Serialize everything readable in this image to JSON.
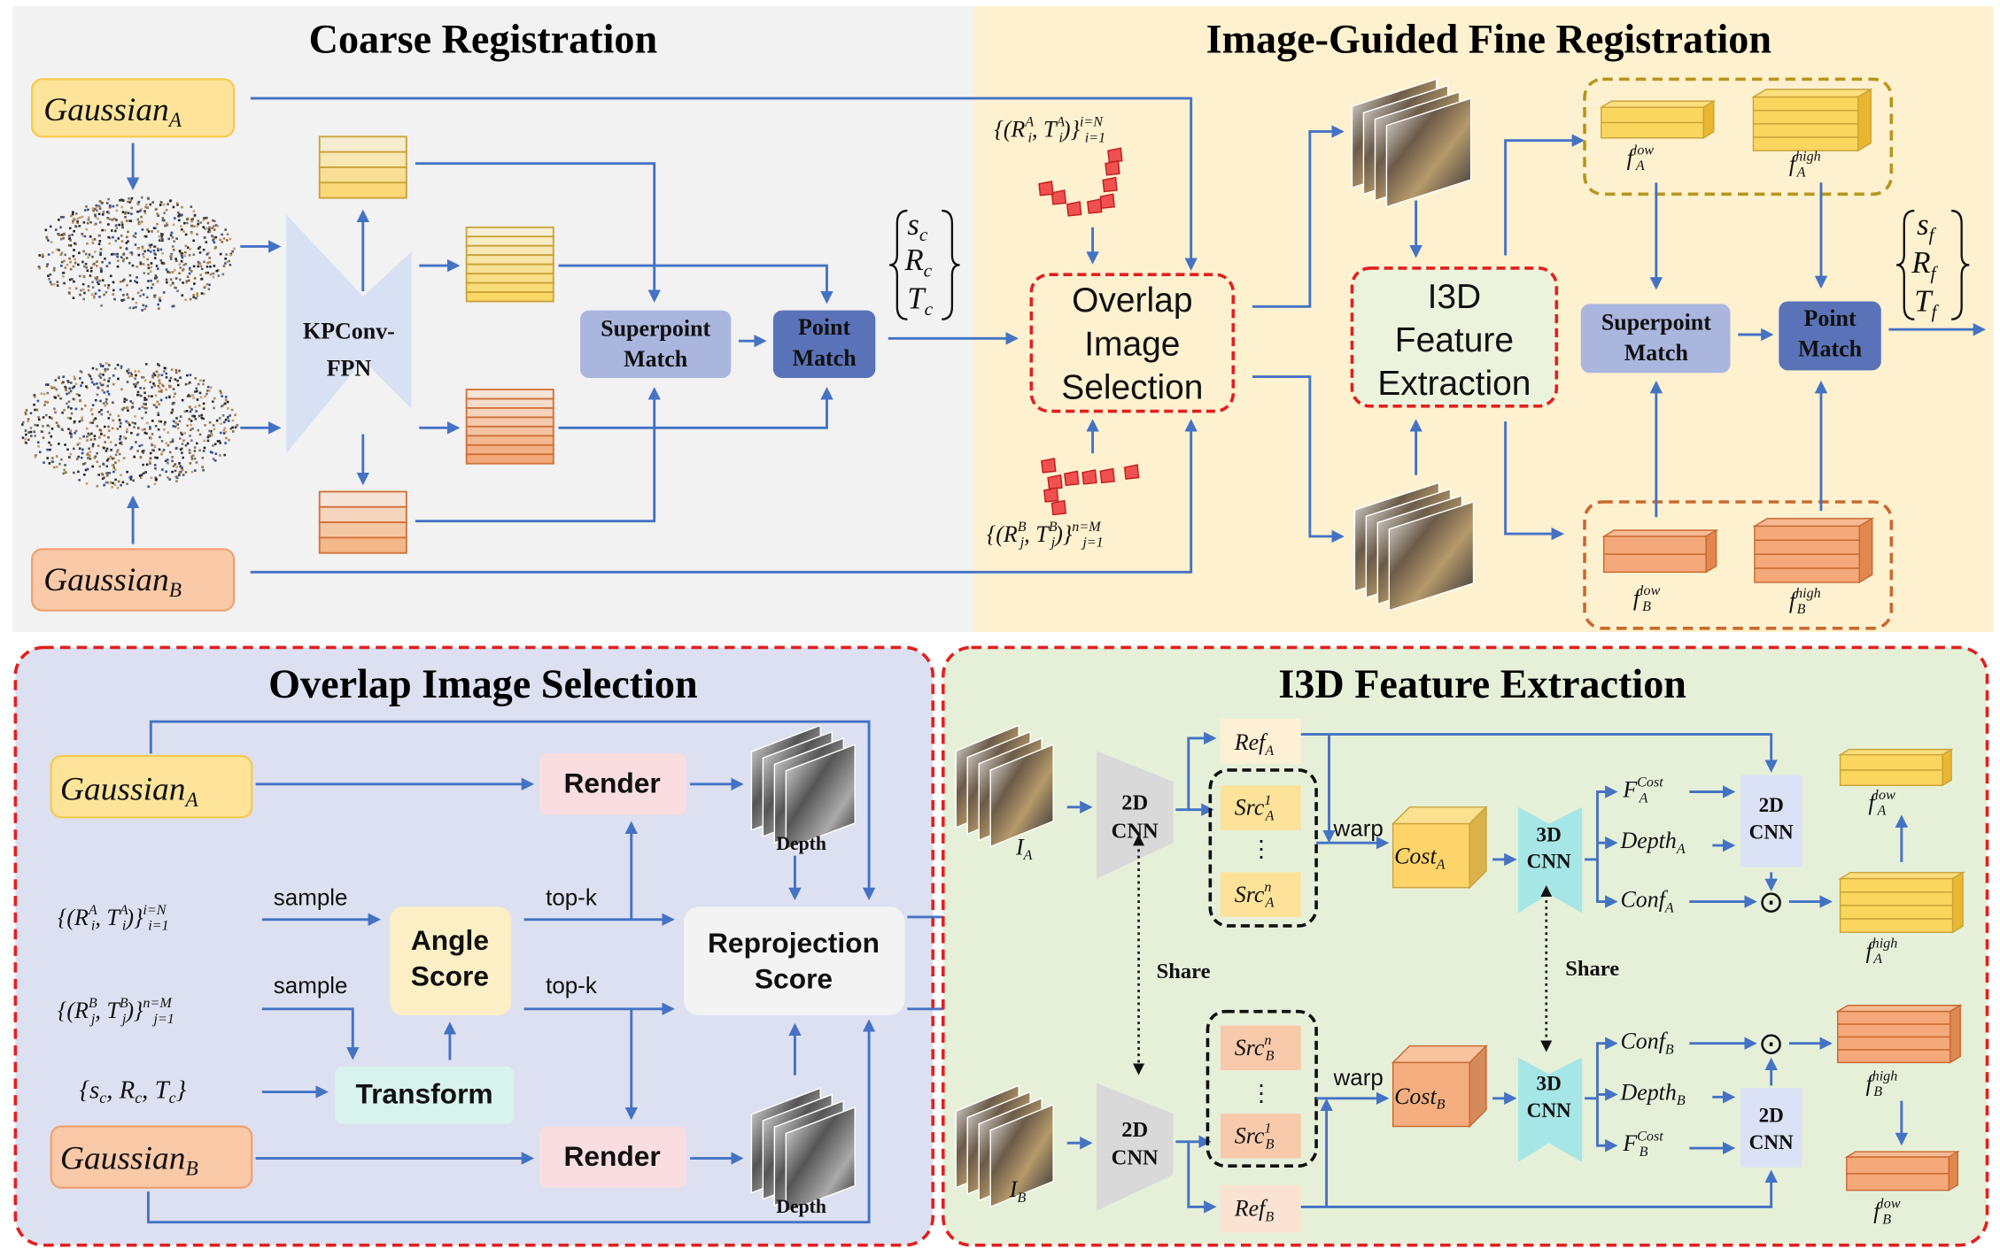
{
  "colors": {
    "arrow": "#4472c4",
    "coarse_bg": "#f2f2f2",
    "fine_bg": "#fdf1cf",
    "overlap_panel_bg": "#dde0f0",
    "i3d_panel_bg": "#e6f0d9",
    "dashed_red": "#e02020",
    "gaussian_a": "#fde49a",
    "gaussian_b": "#f9c9a8",
    "superpoint": "#aab6de",
    "point_match": "#5a73b8",
    "render": "#fadde0",
    "angle": "#fcefc5",
    "transform": "#d8f3ee",
    "cnn3d": "#a6e6e6",
    "cnn2d_gray": "#d9d9d9",
    "cnn2d_blue": "#dbe2f5"
  },
  "icons": {
    "hadamard": "circled-dot-icon",
    "point_cloud": "point-cloud-image",
    "image_stack": "image-stack",
    "camera_poses": "camera-pose-markers"
  },
  "coarse": {
    "title": "Coarse Registration",
    "gaussian_a": {
      "segs": [
        {
          "t": "Gaussian"
        },
        {
          "sub": "A"
        }
      ]
    },
    "gaussian_b": {
      "segs": [
        {
          "t": "Gaussian"
        },
        {
          "sub": "B"
        }
      ]
    },
    "kpconv": [
      "KPConv-",
      "FPN"
    ],
    "superpoint_match": [
      "Superpoint",
      "Match"
    ],
    "point_match": [
      "Point",
      "Match"
    ],
    "output": [
      {
        "segs": [
          {
            "t": "s"
          },
          {
            "sub": "c"
          }
        ]
      },
      {
        "segs": [
          {
            "t": "R"
          },
          {
            "sub": "c"
          }
        ]
      },
      {
        "segs": [
          {
            "t": "T"
          },
          {
            "sub": "c"
          }
        ]
      }
    ]
  },
  "fine": {
    "title": "Image-Guided Fine Registration",
    "poses_a": {
      "segs": [
        {
          "t": "{(R"
        },
        {
          "sub": "i",
          "sup": "A"
        },
        {
          "t": ", T"
        },
        {
          "sub": "i",
          "sup": "A"
        },
        {
          "t": ")}"
        },
        {
          "sub": "i=1",
          "sup": "i=N"
        }
      ]
    },
    "poses_b": {
      "segs": [
        {
          "t": "{(R"
        },
        {
          "sub": "j",
          "sup": "B"
        },
        {
          "t": ", T"
        },
        {
          "sub": "j",
          "sup": "B"
        },
        {
          "t": ")}"
        },
        {
          "sub": "j=1",
          "sup": "n=M"
        }
      ]
    },
    "overlap_selection": [
      "Overlap",
      "Image",
      "Selection"
    ],
    "i3d_extraction": [
      "I3D",
      "Feature",
      "Extraction"
    ],
    "f_a_low": {
      "segs": [
        {
          "t": "f"
        },
        {
          "sub": "A",
          "sup": "low"
        }
      ]
    },
    "f_a_high": {
      "segs": [
        {
          "t": "f"
        },
        {
          "sub": "A",
          "sup": "high"
        }
      ]
    },
    "f_b_low": {
      "segs": [
        {
          "t": "f"
        },
        {
          "sub": "B",
          "sup": "low"
        }
      ]
    },
    "f_b_high": {
      "segs": [
        {
          "t": "f"
        },
        {
          "sub": "B",
          "sup": "high"
        }
      ]
    },
    "superpoint_match": [
      "Superpoint",
      "Match"
    ],
    "point_match": [
      "Point",
      "Match"
    ],
    "output": [
      {
        "segs": [
          {
            "t": "s"
          },
          {
            "sub": "f"
          }
        ]
      },
      {
        "segs": [
          {
            "t": "R"
          },
          {
            "sub": "f"
          }
        ]
      },
      {
        "segs": [
          {
            "t": "T"
          },
          {
            "sub": "f"
          }
        ]
      }
    ]
  },
  "overlap_panel": {
    "title": "Overlap Image Selection",
    "gaussian_a": {
      "segs": [
        {
          "t": "Gaussian"
        },
        {
          "sub": "A"
        }
      ]
    },
    "gaussian_b": {
      "segs": [
        {
          "t": "Gaussian"
        },
        {
          "sub": "B"
        }
      ]
    },
    "render": "Render",
    "depth": "Depth",
    "sample": "sample",
    "topk": "top-k",
    "poses_a": {
      "segs": [
        {
          "t": "{(R"
        },
        {
          "sub": "i",
          "sup": "A"
        },
        {
          "t": ", T"
        },
        {
          "sub": "i",
          "sup": "A"
        },
        {
          "t": ")}"
        },
        {
          "sub": "i=1",
          "sup": "i=N"
        }
      ]
    },
    "poses_b": {
      "segs": [
        {
          "t": "{(R"
        },
        {
          "sub": "j",
          "sup": "B"
        },
        {
          "t": ", T"
        },
        {
          "sub": "j",
          "sup": "B"
        },
        {
          "t": ")}"
        },
        {
          "sub": "j=1",
          "sup": "n=M"
        }
      ]
    },
    "coarse_params": {
      "segs": [
        {
          "t": "{s"
        },
        {
          "sub": "c"
        },
        {
          "t": ", R"
        },
        {
          "sub": "c"
        },
        {
          "t": ", T"
        },
        {
          "sub": "c"
        },
        {
          "t": "}"
        }
      ]
    },
    "angle_score": [
      "Angle",
      "Score"
    ],
    "transform": "Transform",
    "reprojection_score": [
      "Reprojection",
      "Score"
    ]
  },
  "i3d_panel": {
    "title": "I3D Feature Extraction",
    "i_a": {
      "segs": [
        {
          "t": "I"
        },
        {
          "sub": "A"
        }
      ]
    },
    "i_b": {
      "segs": [
        {
          "t": "I"
        },
        {
          "sub": "B"
        }
      ]
    },
    "cnn2d": [
      "2D",
      "CNN"
    ],
    "cnn3d": [
      "3D",
      "CNN"
    ],
    "share": "Share",
    "warp": "warp",
    "vdots": "⋮",
    "ref_a": {
      "segs": [
        {
          "t": "Ref"
        },
        {
          "sub": "A"
        }
      ]
    },
    "ref_b": {
      "segs": [
        {
          "t": "Ref"
        },
        {
          "sub": "B"
        }
      ]
    },
    "src_a_1": {
      "segs": [
        {
          "t": "Src"
        },
        {
          "sub": "A",
          "sup": "1"
        }
      ]
    },
    "src_a_n": {
      "segs": [
        {
          "t": "Src"
        },
        {
          "sub": "A",
          "sup": "n"
        }
      ]
    },
    "src_b_n": {
      "segs": [
        {
          "t": "Src"
        },
        {
          "sub": "B",
          "sup": "n"
        }
      ]
    },
    "src_b_1": {
      "segs": [
        {
          "t": "Src"
        },
        {
          "sub": "B",
          "sup": "1"
        }
      ]
    },
    "cost_a": {
      "segs": [
        {
          "t": "Cost"
        },
        {
          "sub": "A"
        }
      ]
    },
    "cost_b": {
      "segs": [
        {
          "t": "Cost"
        },
        {
          "sub": "B"
        }
      ]
    },
    "f_cost_a": {
      "segs": [
        {
          "t": "F"
        },
        {
          "sub": "A",
          "sup": "Cost"
        }
      ]
    },
    "f_cost_b": {
      "segs": [
        {
          "t": "F"
        },
        {
          "sub": "B",
          "sup": "Cost"
        }
      ]
    },
    "depth_a": {
      "segs": [
        {
          "t": "Depth"
        },
        {
          "sub": "A"
        }
      ]
    },
    "depth_b": {
      "segs": [
        {
          "t": "Depth"
        },
        {
          "sub": "B"
        }
      ]
    },
    "conf_a": {
      "segs": [
        {
          "t": "Conf"
        },
        {
          "sub": "A"
        }
      ]
    },
    "conf_b": {
      "segs": [
        {
          "t": "Conf"
        },
        {
          "sub": "B"
        }
      ]
    },
    "hadamard": "⊙",
    "f_a_low": {
      "segs": [
        {
          "t": "f"
        },
        {
          "sub": "A",
          "sup": "low"
        }
      ]
    },
    "f_a_high": {
      "segs": [
        {
          "t": "f"
        },
        {
          "sub": "A",
          "sup": "high"
        }
      ]
    },
    "f_b_high": {
      "segs": [
        {
          "t": "f"
        },
        {
          "sub": "B",
          "sup": "high"
        }
      ]
    },
    "f_b_low": {
      "segs": [
        {
          "t": "f"
        },
        {
          "sub": "B",
          "sup": "low"
        }
      ]
    }
  }
}
